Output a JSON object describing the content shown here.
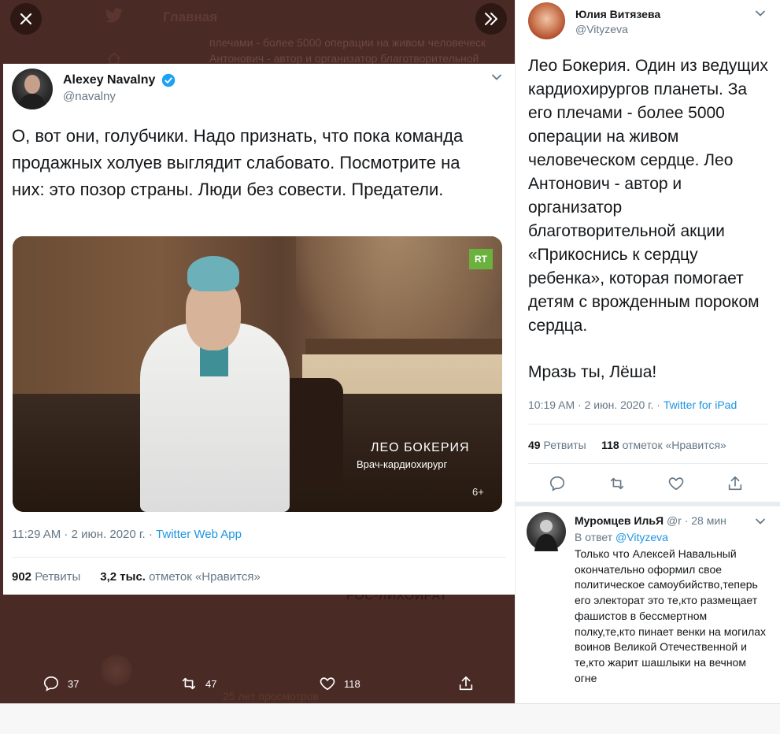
{
  "background": {
    "header_title": "Главная",
    "ghost_line_1": "плечами - более 5000  операции на живом человеческ",
    "ghost_line_2": "Антонович - автор и организатор благотворительной",
    "ghost_mid": "РОС-ЛИХОЙРАТ",
    "ghost_views": "25 лет просмотров"
  },
  "main_tweet": {
    "author_name": "Alexey Navalny",
    "author_handle": "@navalny",
    "text": "О, вот они, голубчики. Надо признать, что пока команда продажных холуев выглядит слабовато. Посмотрите на них: это позор страны. Люди без совести. Предатели.",
    "video": {
      "logo": "RT",
      "caption_name": "ЛЕО БОКЕРИЯ",
      "caption_role": "Врач-кардиохирург",
      "age_rating": "6+"
    },
    "time": "11:29 AM · 2 июн. 2020 г. · ",
    "source": "Twitter Web App",
    "retweets_count": "902",
    "retweets_label": " Ретвиты",
    "likes_count": "3,2 тыс.",
    "likes_label": " отметок «Нравится»",
    "actions": {
      "reply_count": "37",
      "retweet_count": "47",
      "like_count": "118"
    }
  },
  "side_tweet": {
    "author_name": "Юлия Витязева",
    "author_handle": "@Vityzeva",
    "text": "Лео Бокерия. Один из ведущих кардиохирургов планеты. За его плечами - более 5000  операции на живом человеческом сердце. Лео Антонович - автор и организатор благотворительной акции «Прикоснись к сердцу ребенка», которая помогает детям с врожденным пороком сердца.",
    "text2": "Мразь ты, Лёша!",
    "time": "10:19 AM · 2 июн. 2020 г. · ",
    "source": "Twitter for iPad",
    "retweets_count": "49",
    "retweets_label": " Ретвиты",
    "likes_count": "118",
    "likes_label": " отметок «Нравится»"
  },
  "reply_tweet": {
    "author_name": "Муромцев ИльЯ",
    "author_handle": " @r · 28 мин",
    "reply_prefix": "В ответ ",
    "reply_to": "@Vityzeva",
    "text": "Только что Алексей Навальный окончательно оформил свое политическое самоубийство,теперь его электорат это те,кто размещает фашистов в бессмертном полку,те,кто пинает венки на могилах воинов Великой Отечественной и те,кто жарит шашлыки на вечном огне"
  },
  "colors": {
    "overlay": "#4a2a24",
    "link": "#1b95e0",
    "muted": "#657786",
    "verified": "#1da1f2"
  }
}
